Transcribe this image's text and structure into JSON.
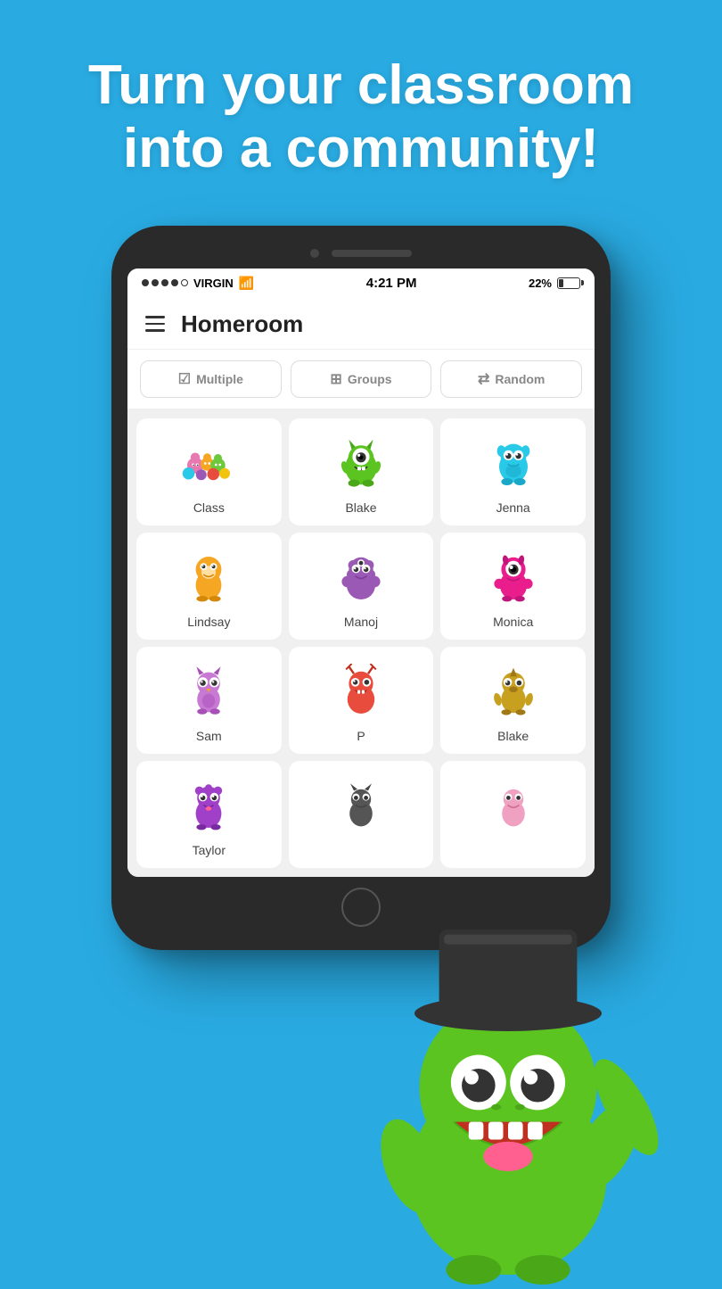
{
  "hero": {
    "title": "Turn your classroom into a community!"
  },
  "status_bar": {
    "carrier": "VIRGIN",
    "time": "4:21 PM",
    "battery_percent": "22%"
  },
  "app": {
    "title": "Homeroom"
  },
  "actions": [
    {
      "id": "multiple",
      "label": "Multiple",
      "icon": "✅"
    },
    {
      "id": "groups",
      "label": "Groups",
      "icon": "⊞"
    },
    {
      "id": "random",
      "label": "Random",
      "icon": "⇄"
    }
  ],
  "grid_items": [
    {
      "id": "class",
      "label": "Class",
      "color": "#e8a0c8",
      "monster_type": "group"
    },
    {
      "id": "blake1",
      "label": "Blake",
      "color": "#6dc83c",
      "monster_type": "green"
    },
    {
      "id": "jenna",
      "label": "Jenna",
      "color": "#29c9e8",
      "monster_type": "cyan"
    },
    {
      "id": "lindsay",
      "label": "Lindsay",
      "color": "#f5a623",
      "monster_type": "orange"
    },
    {
      "id": "manoj",
      "label": "Manoj",
      "color": "#9b59b6",
      "monster_type": "purple"
    },
    {
      "id": "monica",
      "label": "Monica",
      "color": "#e91e8c",
      "monster_type": "magenta"
    },
    {
      "id": "sam",
      "label": "Sam",
      "color": "#c879d4",
      "monster_type": "pink-owl"
    },
    {
      "id": "p",
      "label": "P",
      "color": "#e84c3d",
      "monster_type": "red"
    },
    {
      "id": "blake2",
      "label": "Blake",
      "color": "#c8a020",
      "monster_type": "horned"
    },
    {
      "id": "taylor",
      "label": "Taylor",
      "color": "#a040c8",
      "monster_type": "taylor"
    },
    {
      "id": "extra1",
      "label": "",
      "color": "#888",
      "monster_type": "extra1"
    },
    {
      "id": "extra2",
      "label": "",
      "color": "#f0a0c0",
      "monster_type": "extra2"
    }
  ]
}
